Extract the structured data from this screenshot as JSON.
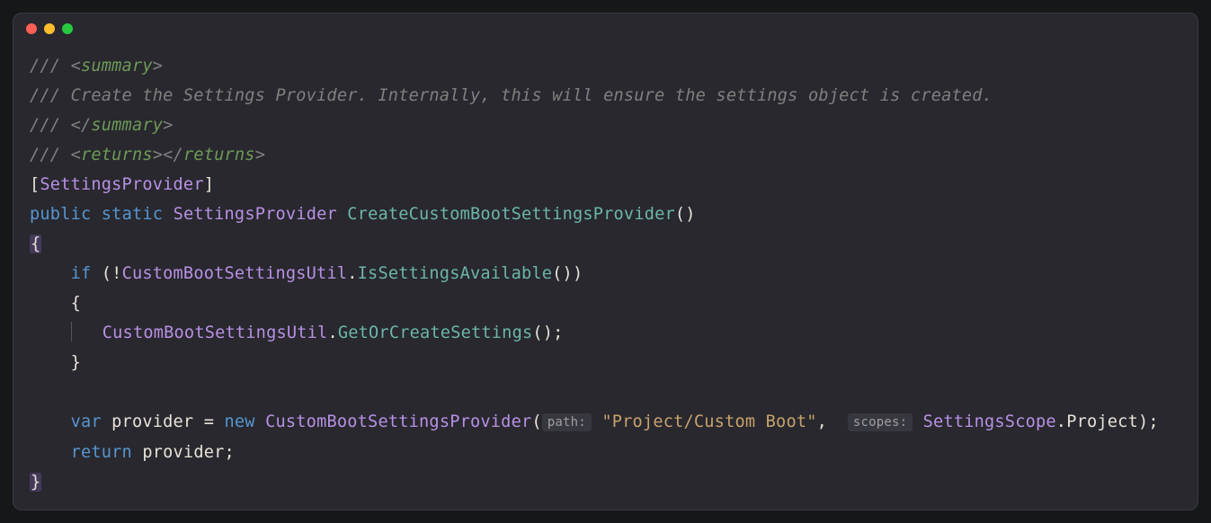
{
  "doc": {
    "l1_pre": "/// <",
    "l1_tag": "summary",
    "l1_suf": ">",
    "l2": "/// Create the Settings Provider. Internally, this will ensure the settings object is created.",
    "l3_pre": "/// </",
    "l3_tag": "summary",
    "l3_suf": ">",
    "l4_pre": "/// <",
    "l4_tag": "returns",
    "l4_mid": "></",
    "l4_tag2": "returns",
    "l4_suf": ">"
  },
  "attr": {
    "open": "[",
    "name": "SettingsProvider",
    "close": "]"
  },
  "sig": {
    "kw_public": "public",
    "kw_static": "static",
    "ret_type": "SettingsProvider",
    "fn_name": "CreateCustomBootSettingsProvider",
    "parens": "()"
  },
  "body": {
    "open": "{",
    "if_kw": "if",
    "if_open": " (!",
    "cls1": "CustomBootSettingsUtil",
    "dot": ".",
    "m1": "IsSettingsAvailable",
    "if_call_close": "())",
    "inner_open": "{",
    "cls2": "CustomBootSettingsUtil",
    "m2": "GetOrCreateSettings",
    "call2_close": "();",
    "inner_close": "}",
    "var_kw": "var",
    "var_name": " provider ",
    "eq": "= ",
    "new_kw": "new",
    "ctor": "CustomBootSettingsProvider",
    "ctor_open": "(",
    "hint_path": "path:",
    "path_str": "\"Project/Custom Boot\"",
    "comma": ", ",
    "hint_scopes": "scopes:",
    "scope_cls": "SettingsScope",
    "scope_member": "Project",
    "ctor_close": ");",
    "return_kw": "return",
    "return_expr": " provider;",
    "close": "}"
  }
}
